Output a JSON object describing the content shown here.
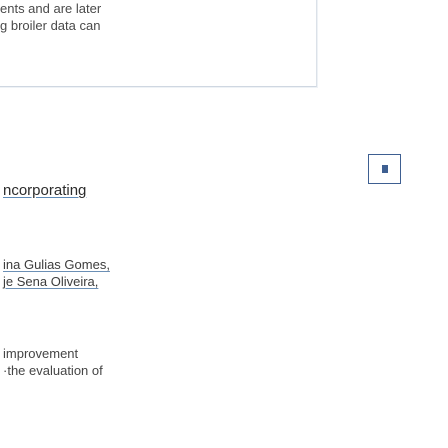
{
  "top_snippet": {
    "line1": "ents and are later",
    "line2": "g broiler data can"
  },
  "result": {
    "title": "ncorporating",
    "authors": [
      "ina Gulias Gomes,",
      "je Sena Oliveira,"
    ],
    "abstract": {
      "line1": "improvement",
      "line2": "·the evaluation of"
    }
  },
  "side_action": {
    "icon": "bookmark-square-icon",
    "color": "#3e5f91"
  }
}
